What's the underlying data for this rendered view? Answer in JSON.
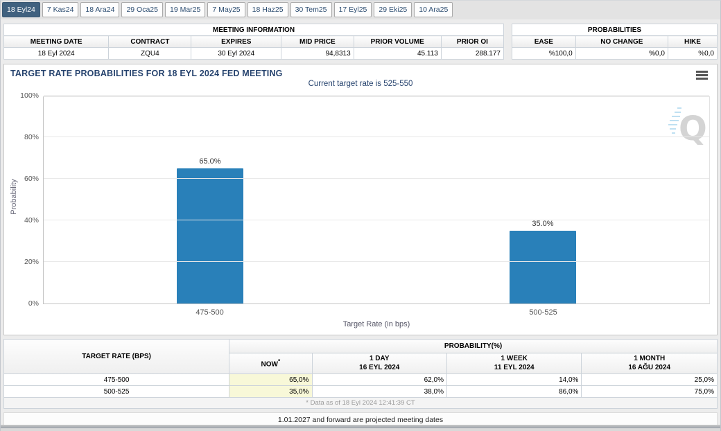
{
  "tabs": [
    {
      "label": "18 Eyl24",
      "active": true
    },
    {
      "label": "7 Kas24",
      "active": false
    },
    {
      "label": "18 Ara24",
      "active": false
    },
    {
      "label": "29 Oca25",
      "active": false
    },
    {
      "label": "19 Mar25",
      "active": false
    },
    {
      "label": "7 May25",
      "active": false
    },
    {
      "label": "18 Haz25",
      "active": false
    },
    {
      "label": "30 Tem25",
      "active": false
    },
    {
      "label": "17 Eyl25",
      "active": false
    },
    {
      "label": "29 Eki25",
      "active": false
    },
    {
      "label": "10 Ara25",
      "active": false
    }
  ],
  "meeting_info": {
    "title": "MEETING INFORMATION",
    "columns": [
      "MEETING DATE",
      "CONTRACT",
      "EXPIRES",
      "MID PRICE",
      "PRIOR VOLUME",
      "PRIOR OI"
    ],
    "values": [
      "18 Eyl 2024",
      "ZQU4",
      "30 Eyl 2024",
      "94,8313",
      "45.113",
      "288.177"
    ],
    "value_align": [
      "center",
      "center",
      "center",
      "right",
      "right",
      "right"
    ],
    "col_widths": [
      "21%",
      "16.5%",
      "18%",
      "14.5%",
      "17.5%",
      "12.5%"
    ]
  },
  "probabilities": {
    "title": "PROBABILITIES",
    "columns": [
      "EASE",
      "NO CHANGE",
      "HIKE"
    ],
    "values": [
      "%100,0",
      "%0,0",
      "%0,0"
    ],
    "col_widths": [
      "31%",
      "45%",
      "24%"
    ]
  },
  "chart": {
    "title": "TARGET RATE PROBABILITIES FOR 18 EYL 2024 FED MEETING",
    "subtitle": "Current target rate is 525-550",
    "menu_icon": "hamburger-menu-icon",
    "watermark_letter": "Q",
    "chart_data": {
      "type": "bar",
      "categories": [
        "475-500",
        "500-525"
      ],
      "values": [
        65.0,
        35.0
      ],
      "value_labels": [
        "65.0%",
        "35.0%"
      ],
      "title": "TARGET RATE PROBABILITIES FOR 18 EYL 2024 FED MEETING",
      "subtitle": "Current target rate is 525-550",
      "xlabel": "Target Rate (in bps)",
      "ylabel": "Probability",
      "ylim": [
        0,
        100
      ],
      "ytick_labels": [
        "0%",
        "20%",
        "40%",
        "60%",
        "80%",
        "100%"
      ],
      "grid": true,
      "legend": "none",
      "bar_color": "#2980b9"
    }
  },
  "prob_table": {
    "rate_header": "TARGET RATE (BPS)",
    "group_header": "PROBABILITY(%)",
    "now_label": "NOW",
    "now_sup": "*",
    "period_headers": [
      {
        "label": "1 DAY",
        "date": "16 EYL 2024"
      },
      {
        "label": "1 WEEK",
        "date": "11 EYL 2024"
      },
      {
        "label": "1 MONTH",
        "date": "16 AĞU 2024"
      }
    ],
    "rows": [
      {
        "rate": "475-500",
        "now": "65,0%",
        "values": [
          "62,0%",
          "14,0%",
          "25,0%"
        ]
      },
      {
        "rate": "500-525",
        "now": "35,0%",
        "values": [
          "38,0%",
          "86,0%",
          "75,0%"
        ]
      }
    ],
    "footnote": "* Data as of 18 Eyl 2024 12:41:39 CT",
    "col_widths": [
      "31.6%",
      "11.6%",
      "18.9%",
      "18.9%",
      "19%"
    ]
  },
  "projection_note": "1.01.2027 and forward are projected meeting dates",
  "colors": {
    "bar": "#2980b9",
    "active_tab": "#40617f",
    "now_highlight": "#f8f8d8",
    "title_navy": "#26436e"
  }
}
